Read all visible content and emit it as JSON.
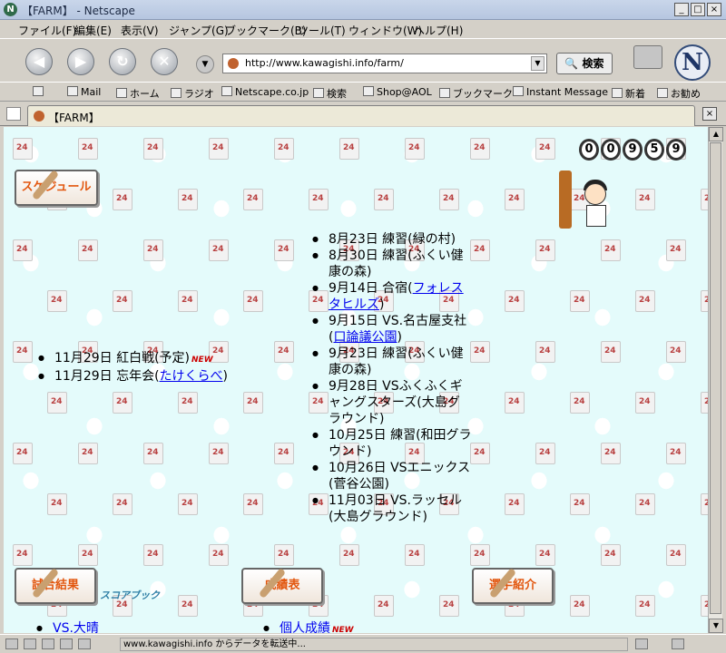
{
  "window": {
    "title": "【FARM】 - Netscape",
    "controls": {
      "minimize": "_",
      "maximize": "□",
      "close": "×"
    }
  },
  "menu": [
    "ファイル(F)",
    "編集(E)",
    "表示(V)",
    "ジャンプ(G)",
    "ブックマーク(B)",
    "ツール(T)",
    "ウィンドウ(W)",
    "ヘルプ(H)"
  ],
  "navigation": {
    "url": "http://www.kawagishi.info/farm/",
    "search_button": "検索"
  },
  "personal_toolbar": [
    "Mail",
    "ホーム",
    "ラジオ",
    "Netscape.co.jp",
    "検索",
    "Shop@AOL",
    "ブックマーク",
    "Instant Message",
    "新着",
    "お勧め"
  ],
  "tab": {
    "label": "【FARM】"
  },
  "counter": [
    "0",
    "0",
    "9",
    "5",
    "9"
  ],
  "page": {
    "schedule_button": "スケジュール",
    "schedule_items": [
      {
        "text": "8月23日 練習(緑の村)"
      },
      {
        "text": "8月30日 練習(ふくい健康の森)"
      },
      {
        "text": "9月14日 合宿(",
        "link": "フォレスタヒルズ",
        "after": ")"
      },
      {
        "text": "9月15日 VS.名古屋支社(",
        "link": "口論議公園",
        "after": ")"
      },
      {
        "text": "9月23日 練習(ふくい健康の森)"
      },
      {
        "text": "9月28日 VSふくふくギャングスターズ(大島グラウンド)"
      },
      {
        "text": "10月25日 練習(和田グラウンド)"
      },
      {
        "text": "10月26日 VSエニックス(菅谷公園)"
      },
      {
        "text": "11月03日 VS.ラッセル(大島グラウンド)"
      }
    ],
    "left_items": [
      {
        "text": "11月29日 紅白戦(予定)",
        "new": "NEW"
      },
      {
        "text": "11月29日 忘年会(",
        "link": "たけくらべ",
        "after": ")"
      }
    ],
    "bottom_buttons": [
      "試合結果",
      "成績表",
      "選手紹介"
    ],
    "scorebook_label": "スコアブック",
    "bottom_links": [
      {
        "text": "VS.大晴"
      },
      {
        "text": "個人成績",
        "new": "NEW"
      }
    ]
  },
  "status": {
    "text": "www.kawagishi.info からデータを転送中..."
  }
}
